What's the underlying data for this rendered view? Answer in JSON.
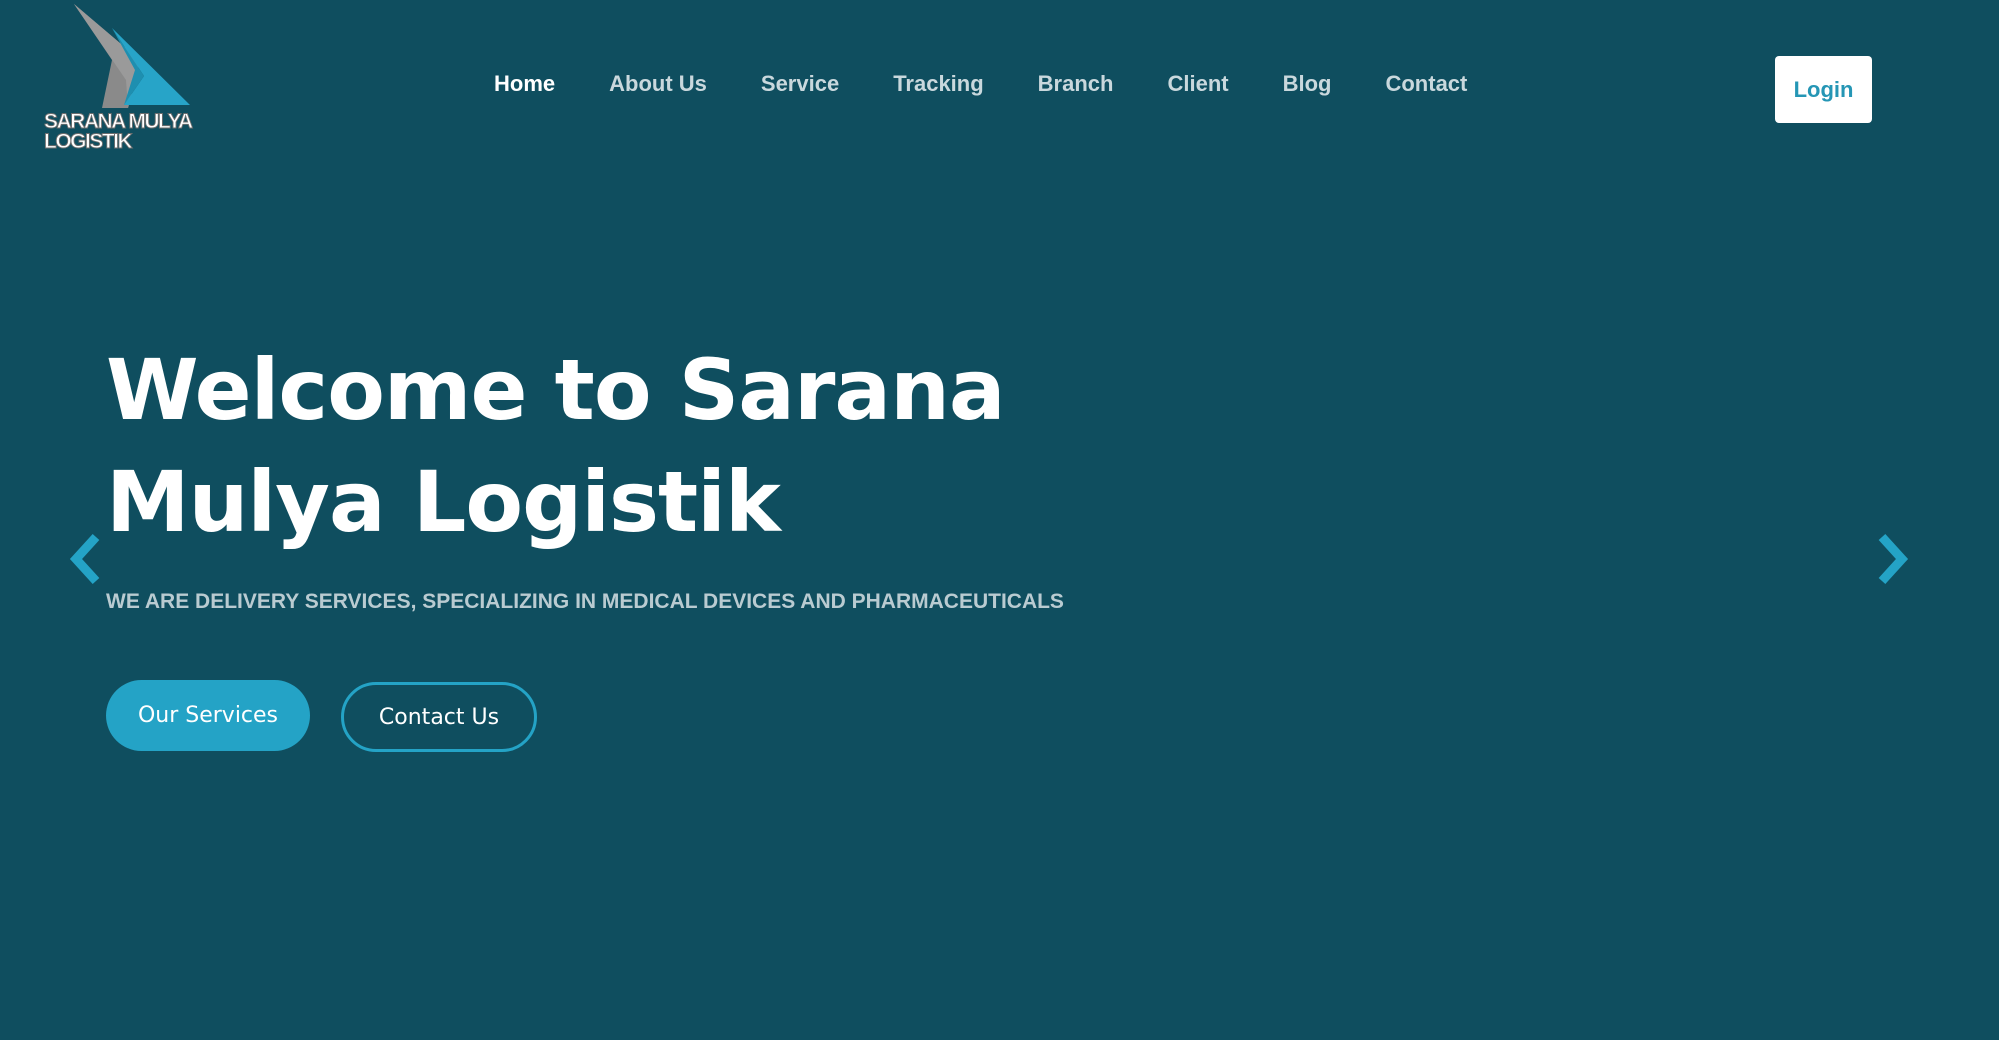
{
  "brand": {
    "name_line1": "SARANA MULYA",
    "name_line2": "LOGISTIK",
    "logo_icon": "chevron-arrow-logo-icon",
    "colors": {
      "grey_chevron": "#8a8a8a",
      "blue_chevron": "#27a4c8"
    }
  },
  "nav": {
    "items": [
      {
        "label": "Home",
        "active": true
      },
      {
        "label": "About Us"
      },
      {
        "label": "Service"
      },
      {
        "label": "Tracking"
      },
      {
        "label": "Branch"
      },
      {
        "label": "Client"
      },
      {
        "label": "Blog"
      },
      {
        "label": "Contact"
      }
    ],
    "login_label": "Login"
  },
  "hero": {
    "title_line1": "Welcome to Sarana",
    "title_line2": "Mulya Logistik",
    "subtitle": "WE ARE DELIVERY SERVICES, SPECIALIZING IN MEDICAL DEVICES AND PHARMACEUTICALS",
    "primary_button": "Our Services",
    "secondary_button": "Contact Us"
  },
  "carousel": {
    "prev_icon": "chevron-left-icon",
    "next_icon": "chevron-right-icon"
  },
  "theme": {
    "background": "#0f4e5f",
    "accent": "#24a3c6",
    "text": "#ffffff",
    "muted_text": "#b9cbd1"
  }
}
